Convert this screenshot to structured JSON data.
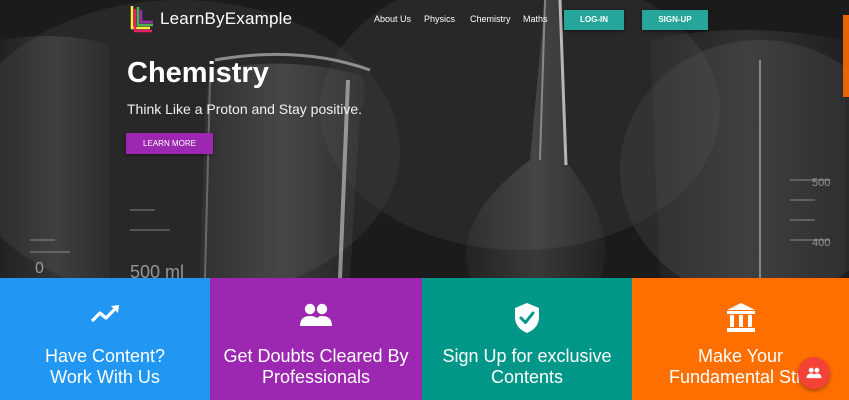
{
  "brand": {
    "name": "LearnByExample"
  },
  "nav": {
    "links": [
      "About Us",
      "Physics",
      "Chemistry",
      "Maths"
    ],
    "login_label": "LOG-IN",
    "signup_label": "SIGN-UP"
  },
  "hero": {
    "title": "Chemistry",
    "subtitle": "Think Like a Proton and Stay positive.",
    "cta_label": "LEARN MORE",
    "beaker_marks": [
      "0",
      "500 ml",
      "500",
      "400"
    ]
  },
  "cards": [
    {
      "title": "Have Content?\nWork With Us",
      "icon": "trending-up-icon",
      "color": "#2196f3"
    },
    {
      "title": "Get Doubts Cleared By\nProfessionals",
      "icon": "people-icon",
      "color": "#9c27b0"
    },
    {
      "title": "Sign Up for exclusive\nContents",
      "icon": "verified-shield-icon",
      "color": "#009688"
    },
    {
      "title": "Make Your\nFundamental Stro",
      "icon": "bank-icon",
      "color": "#ff6f00"
    }
  ],
  "fab": {
    "icon": "people-icon",
    "color": "#f44336"
  }
}
